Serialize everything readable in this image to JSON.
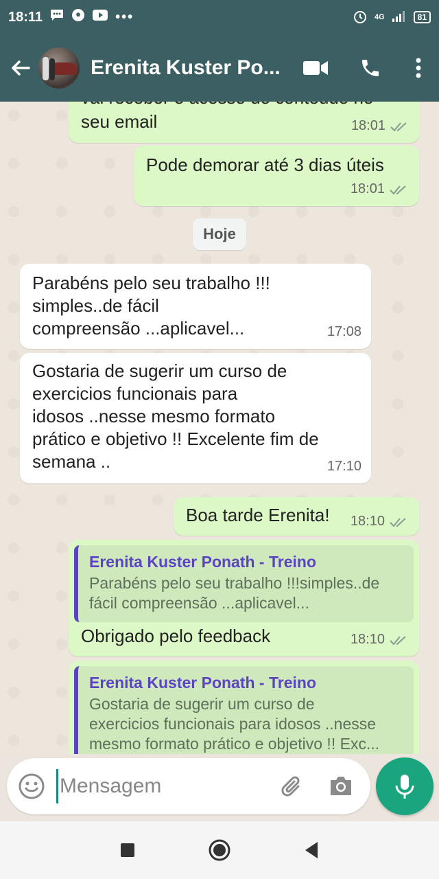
{
  "status_bar": {
    "time": "18:11",
    "network": "4G",
    "battery": "81"
  },
  "header": {
    "contact_name": "Erenita Kuster Po...",
    "icons": [
      "back-arrow-icon",
      "video-call-icon",
      "phone-icon",
      "more-vert-icon"
    ]
  },
  "messages": [
    {
      "dir": "out",
      "text_partial": "vai receber o acesso do conteúdo no",
      "text": "seu email",
      "time": "18:01",
      "status": "read"
    },
    {
      "dir": "out",
      "text": "Pode demorar até 3 dias úteis",
      "time": "18:01",
      "status": "read"
    },
    {
      "dir": "in",
      "lines": [
        "Parabéns pelo seu trabalho !!!",
        "simples..de fácil",
        "compreensão ...aplicavel..."
      ],
      "time": "17:08"
    },
    {
      "dir": "in",
      "lines": [
        "Gostaria de sugerir um curso de",
        "exercicios funcionais para",
        "idosos ..nesse mesmo formato",
        "prático e objetivo !! Excelente fim de",
        "semana .."
      ],
      "time": "17:10"
    },
    {
      "dir": "out",
      "text": "Boa tarde Erenita!",
      "time": "18:10",
      "status": "read"
    },
    {
      "dir": "out",
      "quote_author": "Erenita Kuster Ponath - Treino",
      "quote_lines": [
        "Parabéns pelo seu trabalho !!!simples..de",
        "fácil compreensão ...aplicavel..."
      ],
      "text": "Obrigado pelo feedback",
      "time": "18:10",
      "status": "read"
    },
    {
      "dir": "out",
      "quote_author": "Erenita Kuster Ponath - Treino",
      "quote_lines": [
        "Gostaria de sugerir um curso de",
        "exercicios funcionais para idosos ..nesse",
        "mesmo formato prático e objetivo !! Exc..."
      ]
    }
  ],
  "date_divider": "Hoje",
  "composer": {
    "placeholder": "Mensagem",
    "icons": [
      "emoji-icon",
      "attach-icon",
      "camera-icon",
      "mic-icon"
    ]
  },
  "colors": {
    "header": "#3B5F62",
    "outgoing_bubble": "#DCF8C6",
    "incoming_bubble": "#FFFFFF",
    "quote_accent": "#5B44C4",
    "mic_button": "#1BA57F"
  }
}
